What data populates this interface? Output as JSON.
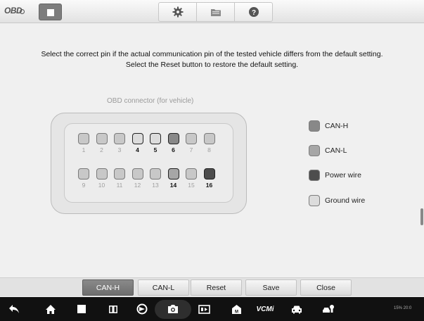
{
  "app": {
    "logo_text": "OBD"
  },
  "toolbar": {
    "icons": [
      "stop-icon",
      "gear-icon",
      "folder-icon",
      "help-icon"
    ]
  },
  "instructions": {
    "line1": "Select the correct pin if the actual communication pin of the tested vehicle differs from the default setting.",
    "line2": "Select the Reset button to restore the default setting."
  },
  "connector": {
    "title": "OBD connector (for vehicle)",
    "top_row": [
      {
        "num": "1",
        "state": "default"
      },
      {
        "num": "2",
        "state": "default"
      },
      {
        "num": "3",
        "state": "default"
      },
      {
        "num": "4",
        "state": "ground"
      },
      {
        "num": "5",
        "state": "ground"
      },
      {
        "num": "6",
        "state": "can-h"
      },
      {
        "num": "7",
        "state": "default"
      },
      {
        "num": "8",
        "state": "default"
      }
    ],
    "bottom_row": [
      {
        "num": "9",
        "state": "default"
      },
      {
        "num": "10",
        "state": "default"
      },
      {
        "num": "11",
        "state": "default"
      },
      {
        "num": "12",
        "state": "default"
      },
      {
        "num": "13",
        "state": "default"
      },
      {
        "num": "14",
        "state": "can-l"
      },
      {
        "num": "15",
        "state": "default"
      },
      {
        "num": "16",
        "state": "power"
      }
    ]
  },
  "legend": [
    {
      "label": "CAN-H",
      "color": "#888888"
    },
    {
      "label": "CAN-L",
      "color": "#a6a6a6"
    },
    {
      "label": "Power wire",
      "color": "#4d4d4d"
    },
    {
      "label": "Ground wire",
      "color": "#dcdcdc"
    }
  ],
  "buttons": [
    {
      "label": "CAN-H",
      "active": true
    },
    {
      "label": "CAN-L",
      "active": false
    },
    {
      "label": "Reset",
      "active": false
    },
    {
      "label": "Save",
      "active": false
    },
    {
      "label": "Close",
      "active": false
    }
  ],
  "navbar": {
    "icons": [
      "back-icon",
      "home-icon",
      "recent-apps-icon",
      "multi-window-icon",
      "browser-icon",
      "camera-icon",
      "screen-record-icon",
      "maxifix-icon",
      "vcmi-icon",
      "car-icon",
      "car-service-icon"
    ],
    "vcm_label": "VCMi",
    "status_text": "15% 20:0"
  }
}
